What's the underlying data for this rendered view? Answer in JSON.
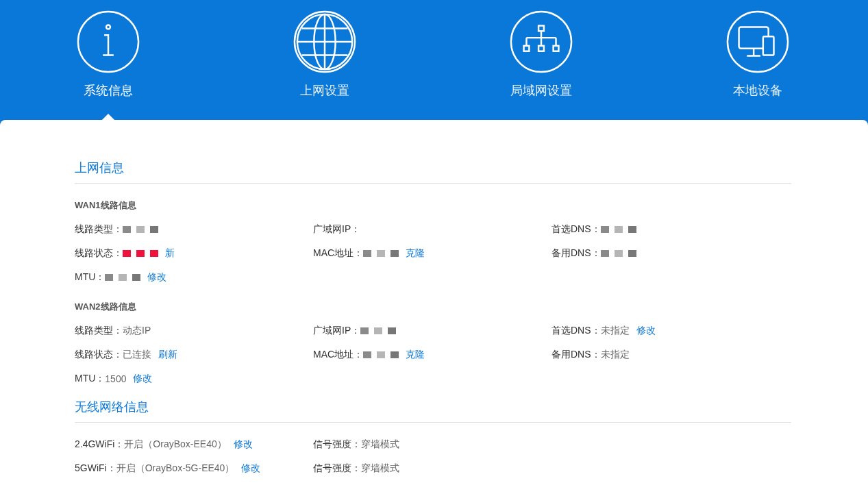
{
  "nav": [
    {
      "label": "系统信息",
      "selected": true
    },
    {
      "label": "上网设置",
      "selected": false
    },
    {
      "label": "局域网设置",
      "selected": false
    },
    {
      "label": "本地设备",
      "selected": false
    }
  ],
  "sections": [
    {
      "title": "上网信息",
      "groups": [
        {
          "title": "WAN1线路信息",
          "rows": [
            [
              {
                "label": "线路类型：",
                "masked": true
              },
              {
                "label": "广域网IP："
              },
              {
                "label": "首选DNS：",
                "masked": true
              }
            ],
            [
              {
                "label": "线路状态：",
                "masked": true,
                "color": "#f0113d",
                "link": "新"
              },
              {
                "label": "MAC地址：",
                "masked": true,
                "link": "克隆"
              },
              {
                "label": "备用DNS：",
                "masked": true
              }
            ],
            [
              {
                "label": "MTU：",
                "masked": true,
                "link": "修改"
              }
            ]
          ]
        },
        {
          "title": "WAN2线路信息",
          "rows": [
            [
              {
                "label": "线路类型：",
                "value": "动态IP"
              },
              {
                "label": "广域网IP：",
                "masked": true
              },
              {
                "label": "首选DNS：",
                "value": "未指定",
                "link": "修改"
              }
            ],
            [
              {
                "label": "线路状态：",
                "value": "已连接",
                "link": "刷新"
              },
              {
                "label": "MAC地址：",
                "masked": true,
                "link": "克隆"
              },
              {
                "label": "备用DNS：",
                "value": "未指定"
              }
            ],
            [
              {
                "label": "MTU：",
                "value": "1500",
                "link": "修改"
              }
            ]
          ]
        }
      ]
    },
    {
      "title": "无线网络信息",
      "groups": [
        {
          "rows": [
            [
              {
                "label": "2.4GWiFi：",
                "value": "开启（OrayBox-EE40）",
                "link": "修改"
              },
              {
                "label": "信号强度：",
                "value": "穿墙模式"
              }
            ],
            [
              {
                "label": "5GWiFi：",
                "value": "开启（OrayBox-5G-EE40）",
                "link": "修改"
              },
              {
                "label": "信号强度：",
                "value": "穿墙模式"
              }
            ]
          ]
        }
      ]
    }
  ]
}
